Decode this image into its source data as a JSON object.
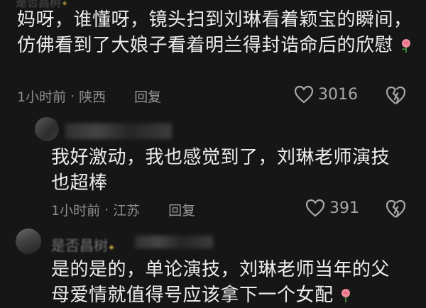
{
  "comment1": {
    "username_partial": "是否昌树",
    "text": "妈呀，谁懂呀，镜头扫到刘琳看着颖宝的瞬间，仿佛看到了大娘子看着明兰得封诰命后的欣慰",
    "time": "1小时前",
    "location": "陕西",
    "reply_label": "回复",
    "likes": "3016"
  },
  "reply1": {
    "text": "我好激动，我也感觉到了，刘琳老师演技也超棒",
    "time": "1小时前",
    "location": "江苏",
    "reply_label": "回复",
    "likes": "391"
  },
  "reply2": {
    "username_partial": "是否昌树",
    "text": "是的是的，单论演技，刘琳老师当年的父母爱情就值得号应该拿下一个女配"
  },
  "icons": {
    "like": "heart-outline-icon",
    "dislike": "broken-heart-icon",
    "emoji": "rose-emoji"
  },
  "colors": {
    "background": "#161616",
    "text": "#ededed",
    "meta": "#8e8e8e"
  }
}
